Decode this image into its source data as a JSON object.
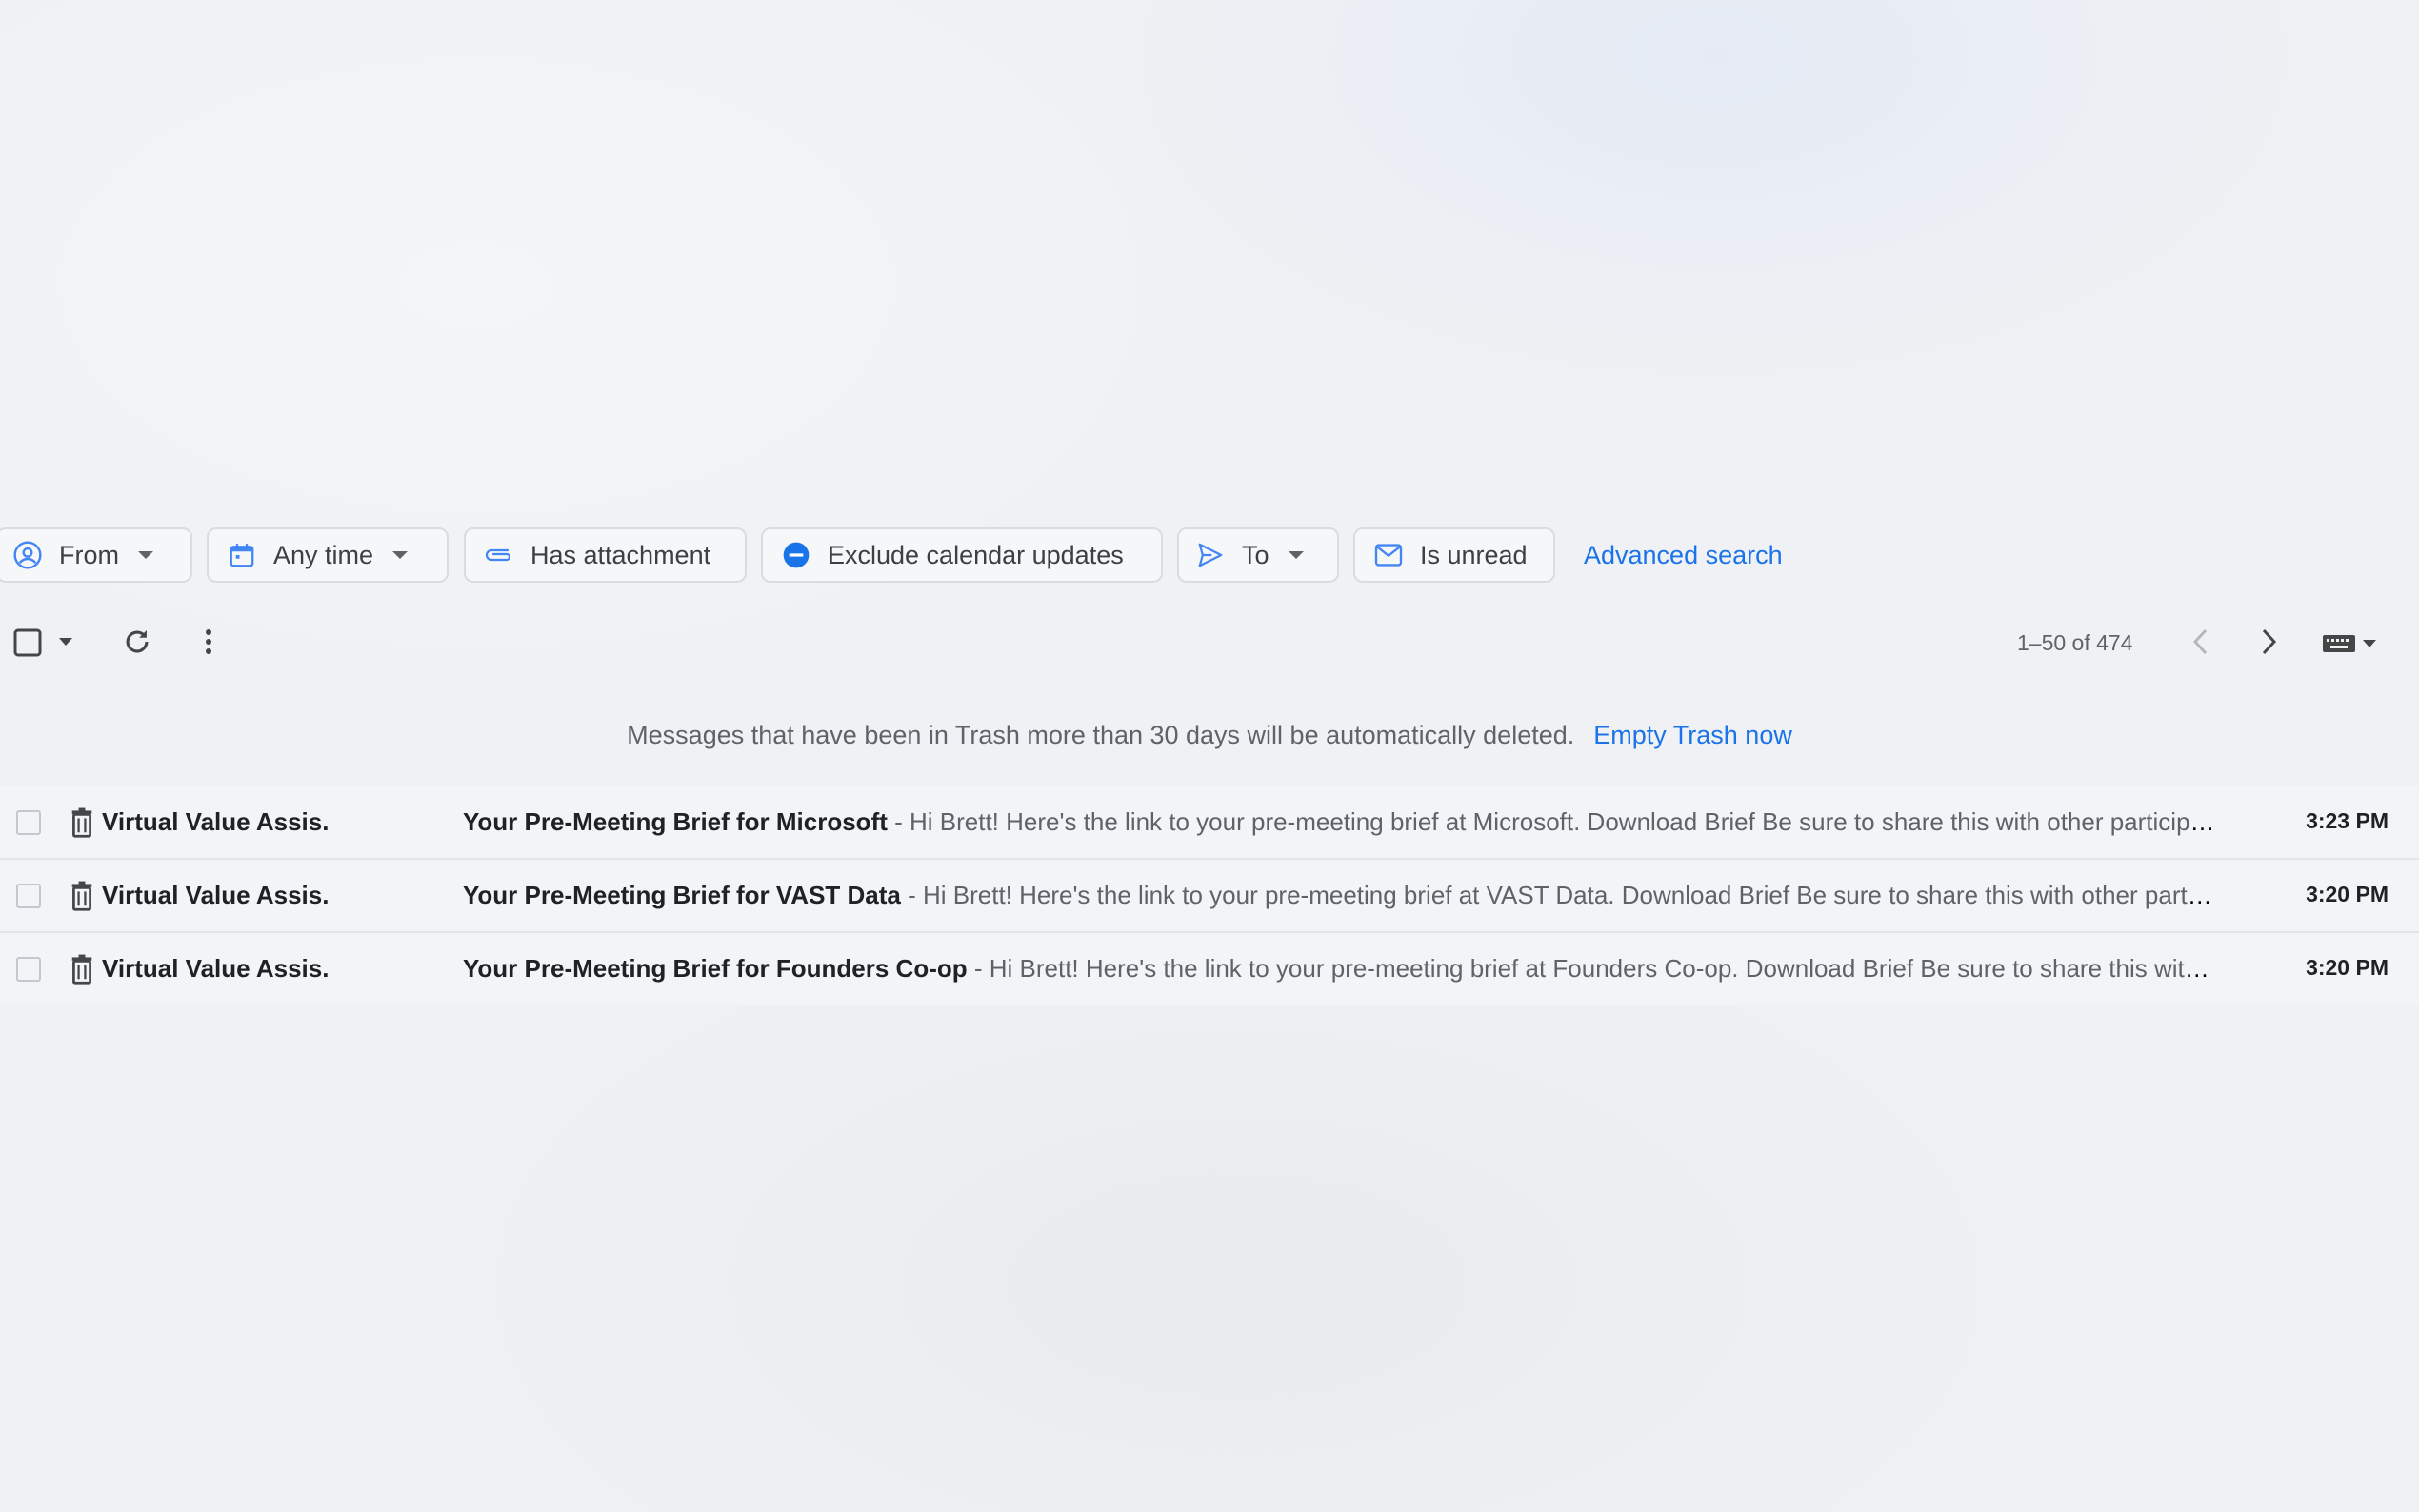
{
  "chips": {
    "from": {
      "label": "From",
      "icon": "account-circle-icon"
    },
    "any_time": {
      "label": "Any time",
      "icon": "calendar-icon"
    },
    "has_attachment": {
      "label": "Has attachment",
      "icon": "paperclip-icon"
    },
    "exclude_calendar": {
      "label": "Exclude calendar updates",
      "icon": "minus-circle-icon"
    },
    "to": {
      "label": "To",
      "icon": "send-icon"
    },
    "is_unread": {
      "label": "Is unread",
      "icon": "envelope-icon"
    },
    "advanced_search": "Advanced search"
  },
  "toolbar": {
    "pagination": "1–50 of 474"
  },
  "trash_notice": {
    "message": "Messages that have been in Trash more than 30 days will be automatically deleted.",
    "action": "Empty Trash now"
  },
  "emails": [
    {
      "sender": "Virtual Value Assis.",
      "subject": "Your Pre-Meeting Brief for Microsoft",
      "snippet": " - Hi Brett! Here's the link to your pre-meeting brief at Microsoft. Download Brief Be sure to share this with other participants",
      "time": "3:23 PM"
    },
    {
      "sender": "Virtual Value Assis.",
      "subject": "Your Pre-Meeting Brief for VAST Data",
      "snippet": " - Hi Brett! Here's the link to your pre-meeting brief at VAST Data. Download Brief Be sure to share this with other participants",
      "time": "3:20 PM"
    },
    {
      "sender": "Virtual Value Assis.",
      "subject": "Your Pre-Meeting Brief for Founders Co-op",
      "snippet": " - Hi Brett! Here's the link to your pre-meeting brief at Founders Co-op. Download Brief Be sure to share this with other participants",
      "time": "3:20 PM"
    }
  ],
  "colors": {
    "accent": "#1a73e8",
    "text": "#202124",
    "muted": "#5f6368"
  }
}
